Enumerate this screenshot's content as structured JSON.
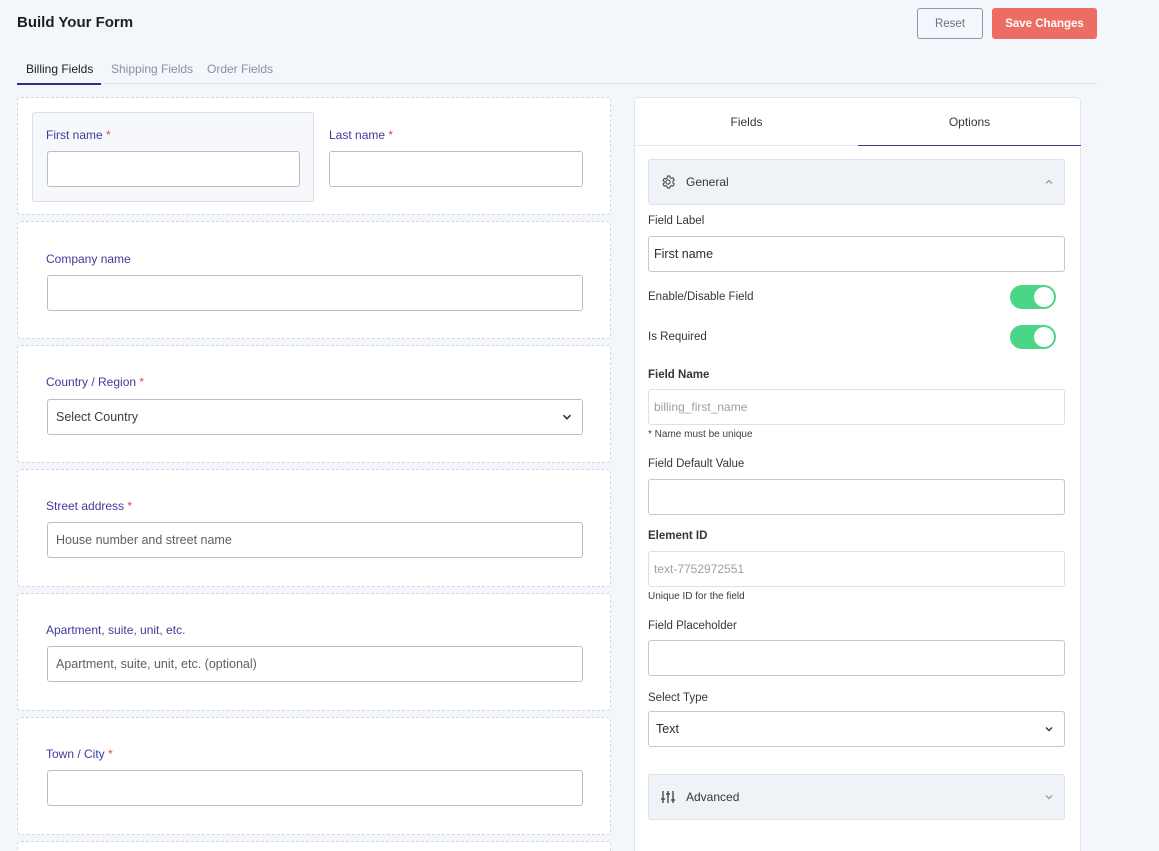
{
  "header": {
    "title": "Build Your Form",
    "reset_label": "Reset",
    "save_label": "Save Changes"
  },
  "tabs": [
    {
      "label": "Billing Fields",
      "active": true
    },
    {
      "label": "Shipping Fields",
      "active": false
    },
    {
      "label": "Order Fields",
      "active": false
    }
  ],
  "form": {
    "first_name": {
      "label": "First name",
      "required": "*",
      "value": ""
    },
    "last_name": {
      "label": "Last name",
      "required": "*",
      "value": ""
    },
    "company": {
      "label": "Company name",
      "value": ""
    },
    "country": {
      "label": "Country / Region",
      "required": "*",
      "selected": "Select Country"
    },
    "street": {
      "label": "Street address",
      "required": "*",
      "placeholder": "House number and street name"
    },
    "apartment": {
      "label": "Apartment, suite, unit, etc.",
      "placeholder": "Apartment, suite, unit, etc. (optional)"
    },
    "city": {
      "label": "Town / City",
      "required": "*",
      "value": ""
    }
  },
  "panel": {
    "tabs": [
      {
        "label": "Fields",
        "active": false
      },
      {
        "label": "Options",
        "active": true
      }
    ],
    "general_label": "General",
    "field_label": {
      "label": "Field Label",
      "value": "First name"
    },
    "enable_field": {
      "label": "Enable/Disable Field",
      "on": true
    },
    "is_required": {
      "label": "Is Required",
      "on": true
    },
    "field_name": {
      "label": "Field Name",
      "value": "billing_first_name",
      "hint": "* Name must be unique"
    },
    "default_value": {
      "label": "Field Default Value",
      "value": ""
    },
    "element_id": {
      "label": "Element ID",
      "value": "text-7752972551",
      "hint": "Unique ID for the field"
    },
    "placeholder": {
      "label": "Field Placeholder",
      "value": ""
    },
    "select_type": {
      "label": "Select Type",
      "selected": "Text"
    },
    "advanced_label": "Advanced"
  },
  "colors": {
    "accent": "#3e3b9b",
    "save": "#ed6c63",
    "toggle_on": "#4bd687",
    "required": "#e04848"
  },
  "icons": {
    "general": "gear-icon",
    "advanced": "sliders-icon",
    "general_chevron": "chevron-up-icon",
    "advanced_chevron": "chevron-down-icon",
    "select_chevron": "chevron-down-icon"
  }
}
